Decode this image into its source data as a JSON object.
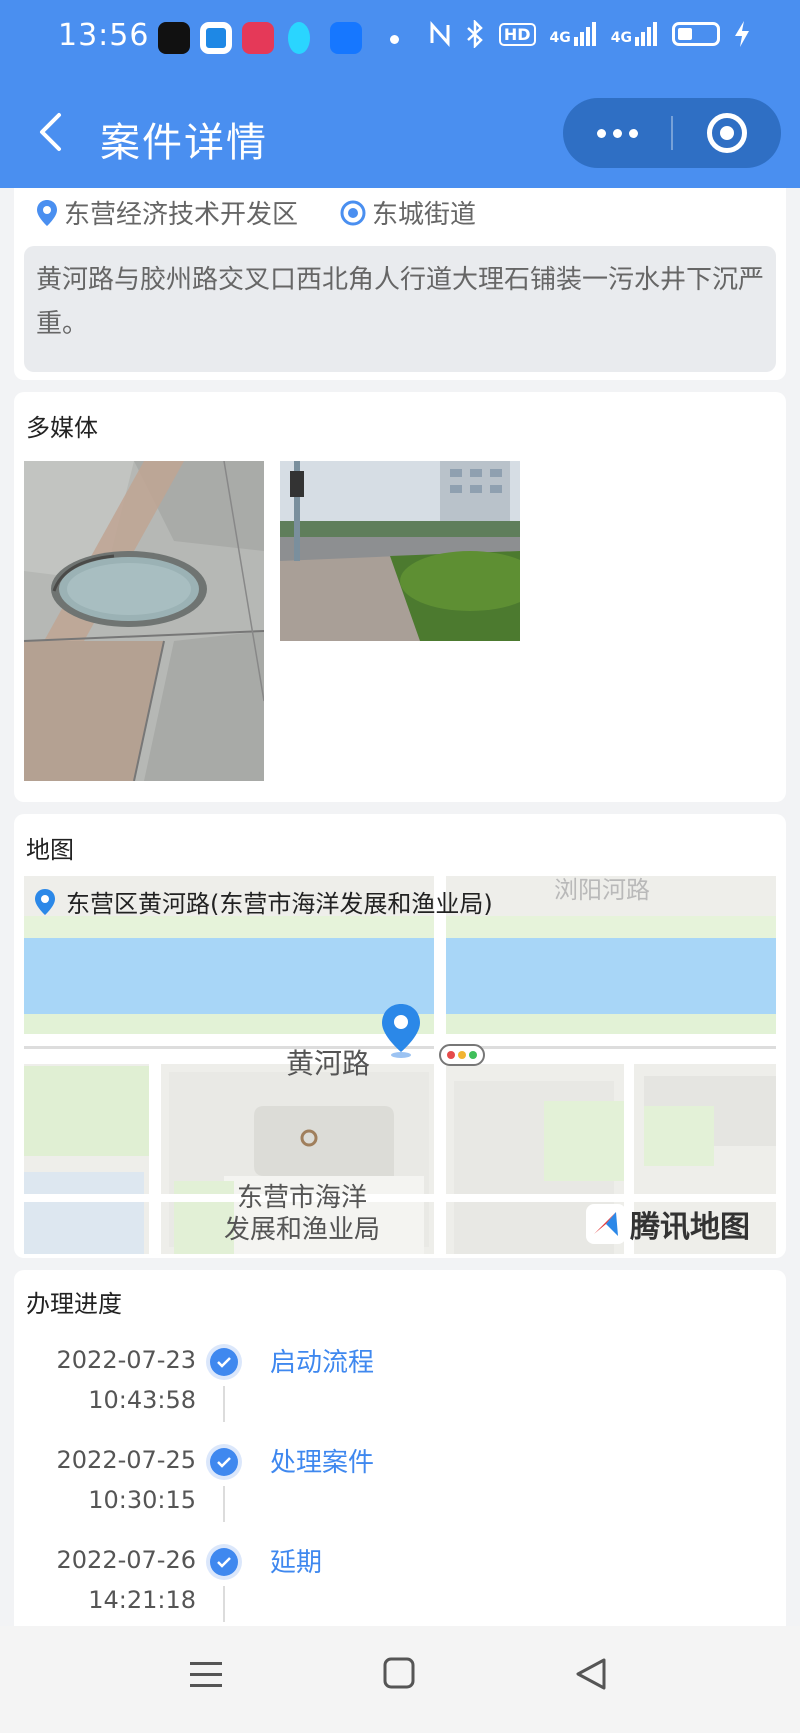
{
  "status_bar": {
    "time": "13:56",
    "net1": "4G",
    "net2": "4G",
    "hd": "HD"
  },
  "navbar": {
    "title": "案件详情"
  },
  "location": {
    "district": "东营经济技术开发区",
    "street": "东城街道"
  },
  "description": "黄河路与胶州路交叉口西北角人行道大理石铺装一污水井下沉严重。",
  "media": {
    "title": "多媒体"
  },
  "map": {
    "title": "地图",
    "address": "东营区黄河路(东营市海洋发展和渔业局)",
    "road_top": "浏阳河路",
    "road_main": "黄河路",
    "poi_line1": "东营市海洋",
    "poi_line2": "发展和渔业局",
    "brand": "腾讯地图"
  },
  "progress": {
    "title": "办理进度",
    "items": [
      {
        "date": "2022-07-23",
        "time": "10:43:58",
        "label": "启动流程"
      },
      {
        "date": "2022-07-25",
        "time": "10:30:15",
        "label": "处理案件"
      },
      {
        "date": "2022-07-26",
        "time": "14:21:18",
        "label": "延期"
      }
    ]
  },
  "colors": {
    "primary": "#4a8ff0",
    "accent": "#3f88ef",
    "capsule": "#2f6fc4",
    "water": "#a8d6f7"
  },
  "icons": [
    "back-icon",
    "more-icon",
    "close-capsule-icon",
    "location-pin-icon",
    "location-target-icon",
    "check-icon",
    "menu-icon",
    "home-icon",
    "back-triangle-icon"
  ]
}
